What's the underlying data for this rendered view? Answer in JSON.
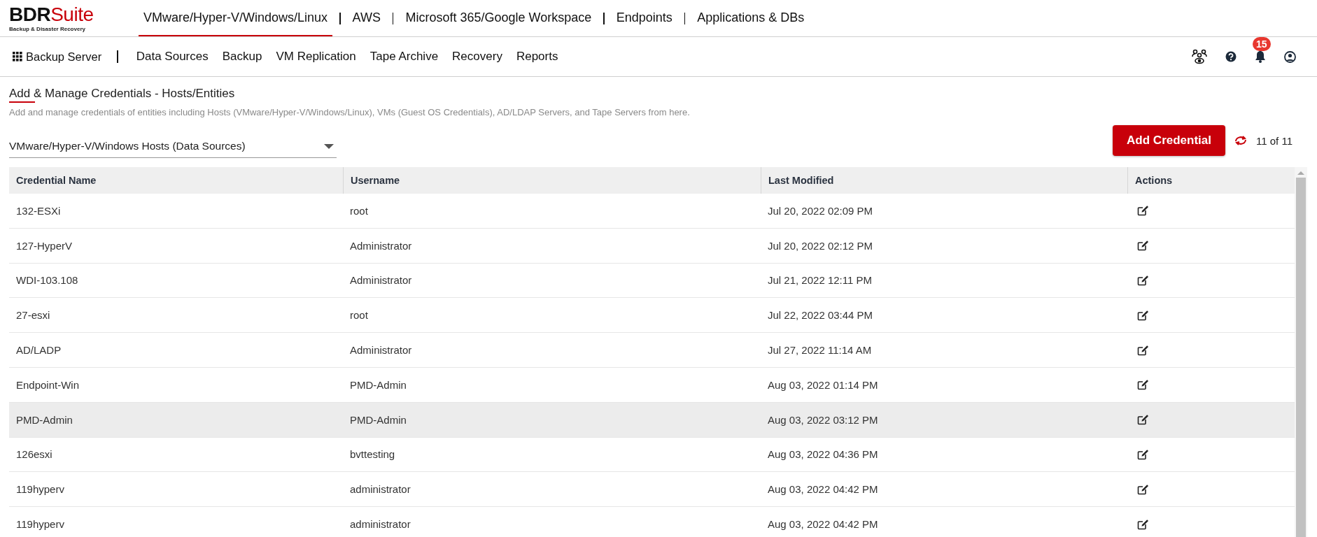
{
  "logo": {
    "title": "BDRSuite",
    "subtitle": "Backup & Disaster Recovery"
  },
  "top_tabs": [
    {
      "label": "VMware/Hyper-V/Windows/Linux",
      "selected": true
    },
    {
      "label": "AWS",
      "selected": false
    },
    {
      "label": "Microsoft 365/Google Workspace",
      "selected": false
    },
    {
      "label": "Endpoints",
      "selected": false
    },
    {
      "label": "Applications & DBs",
      "selected": false
    }
  ],
  "server_menu": {
    "label": "Backup Server"
  },
  "nav_items": [
    "Data Sources",
    "Backup",
    "VM Replication",
    "Tape Archive",
    "Recovery",
    "Reports"
  ],
  "notifications": {
    "count": "15"
  },
  "page": {
    "title": "Add & Manage Credentials - Hosts/Entities",
    "description": "Add and manage credentials of entities including Hosts (VMware/Hyper-V/Windows/Linux), VMs (Guest OS Credentials), AD/LDAP Servers, and Tape Servers from here."
  },
  "filter": {
    "value": "VMware/Hyper-V/Windows Hosts (Data Sources)"
  },
  "add_button": "Add Credential",
  "record_count": "11 of 11",
  "table": {
    "columns": [
      "Credential Name",
      "Username",
      "Last Modified",
      "Actions"
    ],
    "rows": [
      {
        "name": "132-ESXi",
        "username": "root",
        "modified": "Jul 20, 2022 02:09 PM",
        "selected": false
      },
      {
        "name": "127-HyperV",
        "username": "Administrator",
        "modified": "Jul 20, 2022 02:12 PM",
        "selected": false
      },
      {
        "name": "WDI-103.108",
        "username": "Administrator",
        "modified": "Jul 21, 2022 12:11 PM",
        "selected": false
      },
      {
        "name": "27-esxi",
        "username": "root",
        "modified": "Jul 22, 2022 03:44 PM",
        "selected": false
      },
      {
        "name": "AD/LADP",
        "username": "Administrator",
        "modified": "Jul 27, 2022 11:14 AM",
        "selected": false
      },
      {
        "name": "Endpoint-Win",
        "username": "PMD-Admin",
        "modified": "Aug 03, 2022 01:14 PM",
        "selected": false
      },
      {
        "name": "PMD-Admin",
        "username": "PMD-Admin",
        "modified": "Aug 03, 2022 03:12 PM",
        "selected": true
      },
      {
        "name": "126esxi",
        "username": "bvttesting",
        "modified": "Aug 03, 2022 04:36 PM",
        "selected": false
      },
      {
        "name": "119hyperv",
        "username": "administrator",
        "modified": "Aug 03, 2022 04:42 PM",
        "selected": false
      },
      {
        "name": "119hyperv",
        "username": "administrator",
        "modified": "Aug 03, 2022 04:42 PM",
        "selected": false
      }
    ]
  }
}
